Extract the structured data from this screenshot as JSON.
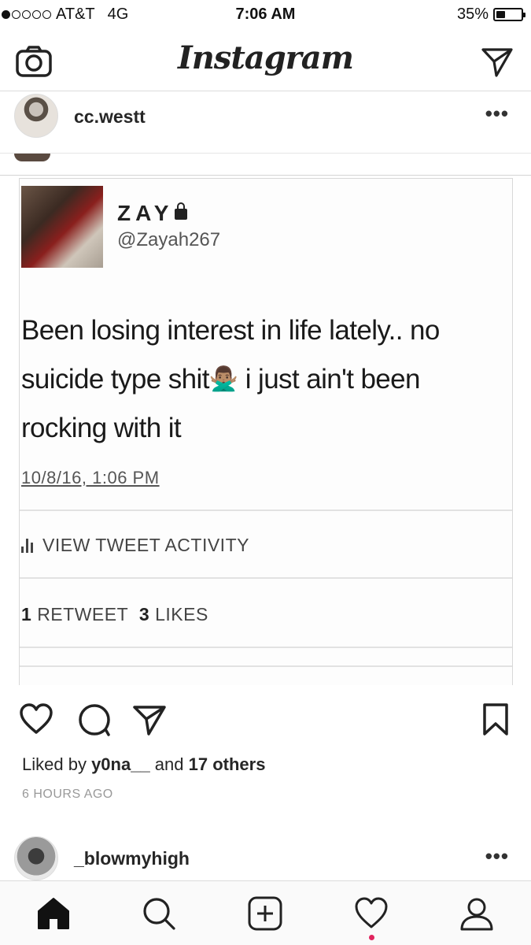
{
  "status_bar": {
    "carrier": "AT&T",
    "network": "4G",
    "time": "7:06 AM",
    "battery_percent": "35%",
    "battery_level": 0.35,
    "signal_bars": 1
  },
  "header": {
    "logo": "Instagram",
    "camera_icon": "camera-icon",
    "direct_icon": "paper-plane-icon"
  },
  "post": {
    "username": "cc.westt",
    "more": "•••",
    "tweet": {
      "name": "ZAY",
      "handle": "@Zayah267",
      "text_line1": "Been losing interest in life lately.. no",
      "text_line2_a": "suicide type shit",
      "emoji": "🙅🏽‍♂️",
      "text_line2_b": " i just ain't been",
      "text_line3": "rocking with it",
      "date": "10/8/16, 1:06 PM",
      "activity": "VIEW TWEET ACTIVITY",
      "retweets_count": "1",
      "retweets_label": "RETWEET",
      "likes_count": "3",
      "likes_label": "LIKES"
    },
    "liked_by_prefix": "Liked by ",
    "liked_by_user": "y0na__",
    "liked_by_middle": " and ",
    "liked_by_others": "17 others",
    "time_ago": "6 HOURS AGO"
  },
  "next_post": {
    "username": "_blowmyhigh",
    "more": "•••"
  },
  "tabbar": {
    "items": [
      "home-icon",
      "search-icon",
      "add-post-icon",
      "heart-icon",
      "profile-icon"
    ]
  },
  "colors": {
    "text": "#262626",
    "secondary": "#999999",
    "notification": "#e0245e"
  }
}
